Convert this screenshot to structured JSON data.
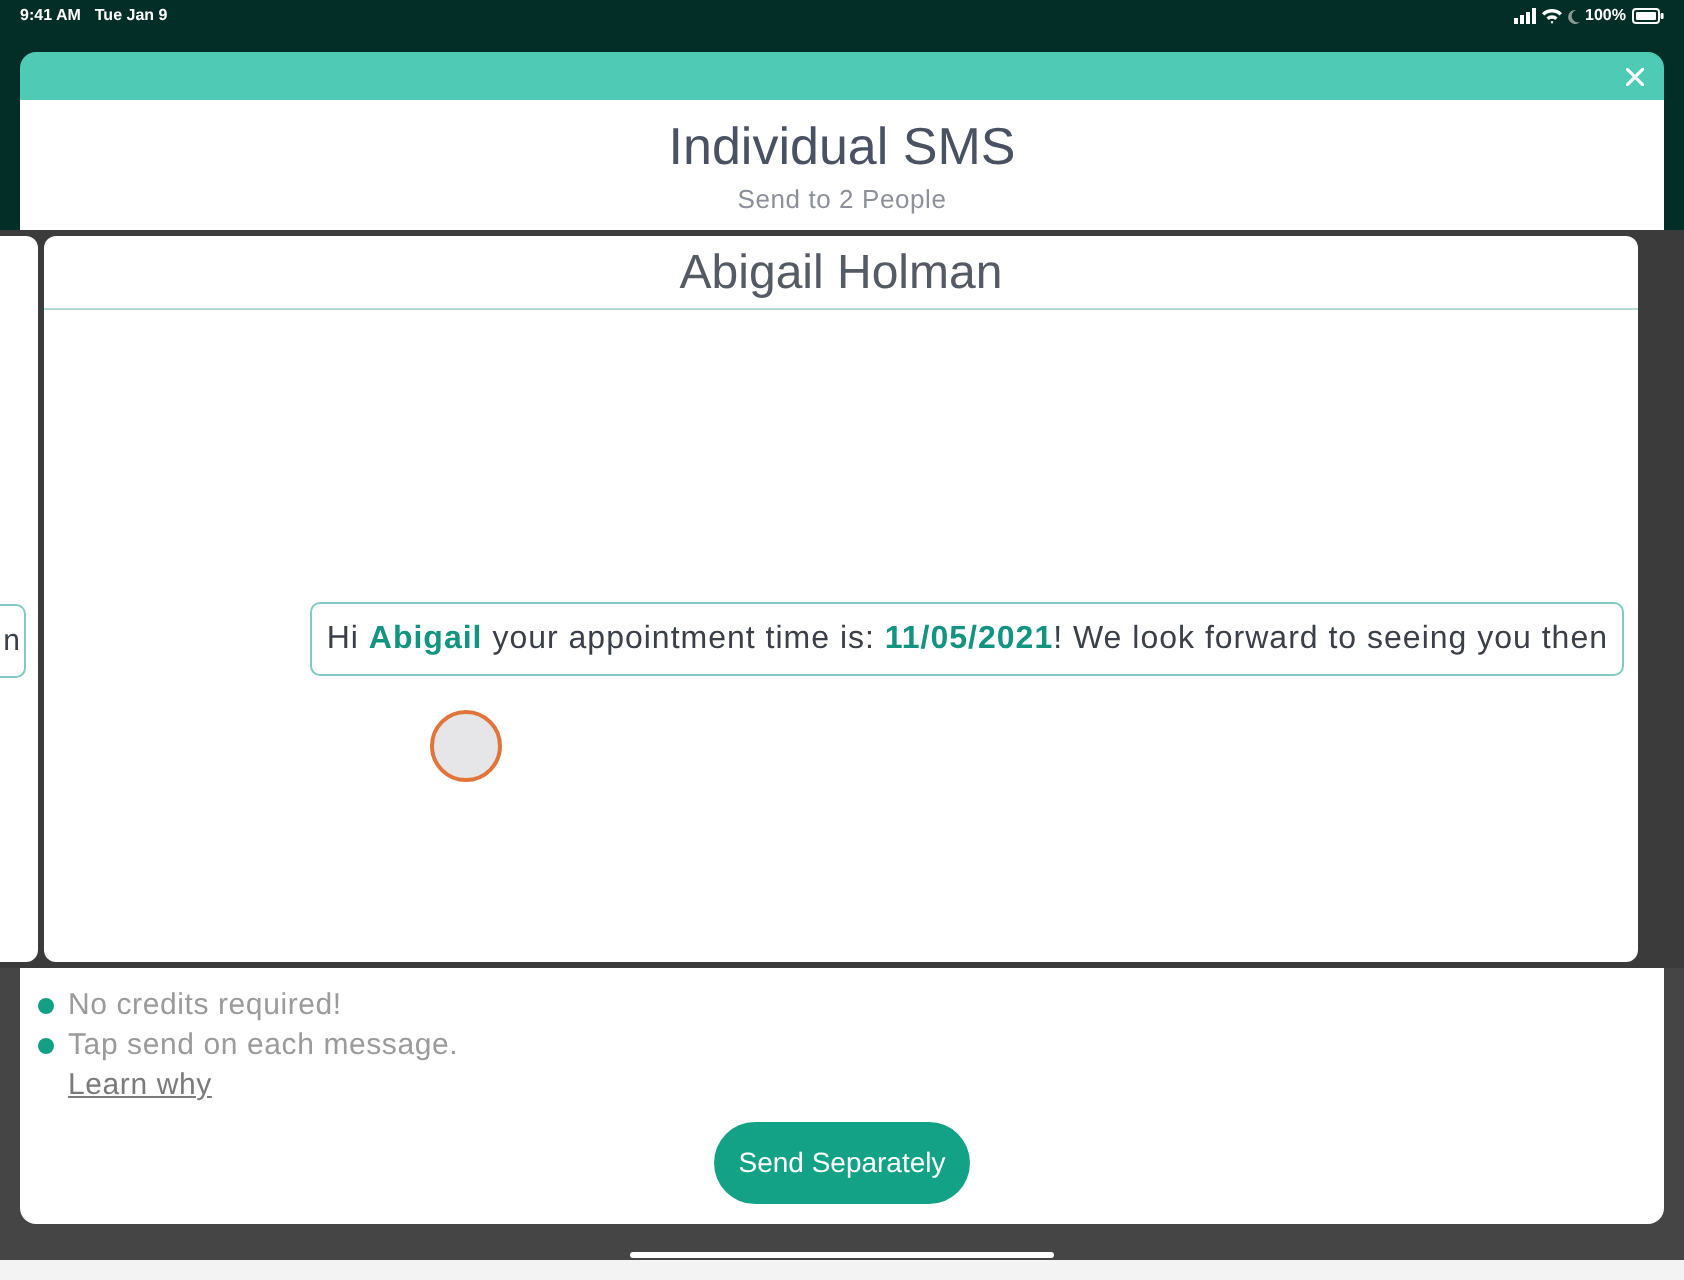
{
  "status_bar": {
    "time": "9:41 AM",
    "date": "Tue Jan 9",
    "battery": "100%"
  },
  "dialog": {
    "title": "Individual SMS",
    "subtitle": "Send to 2 People"
  },
  "previous_card": {
    "message": "n"
  },
  "current_card": {
    "recipient": "Abigail Holman",
    "message": "Hi **Abigail** your appointment time is: **11/05/2021**! We look forward to seeing you then"
  },
  "notes": [
    "No credits required!",
    "Tap send on each message."
  ],
  "learn_link": "Learn why",
  "send_button": "Send Separately"
}
